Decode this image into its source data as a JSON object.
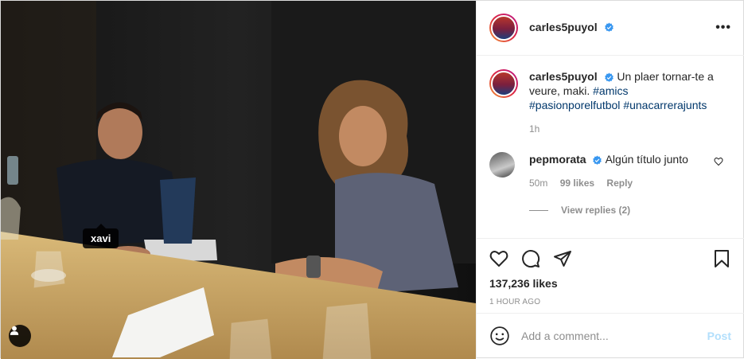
{
  "photo": {
    "tag_label": "xavi",
    "alt": ""
  },
  "header": {
    "username": "carles5puyol",
    "more_label": "•••"
  },
  "caption": {
    "username": "carles5puyol",
    "text": "Un plaer tornar-te a veure, maki.",
    "hashtags": [
      "#amics",
      "#pasionporelfutbol",
      "#unacarrerajunts"
    ],
    "time": "1h"
  },
  "comment": {
    "username": "pepmorata",
    "text": "Algún título junto",
    "time": "50m",
    "likes": "99 likes",
    "reply": "Reply",
    "view_replies": "View replies (2)"
  },
  "actions": {
    "icons": [
      "heart-icon",
      "comment-icon",
      "share-icon",
      "bookmark-icon"
    ],
    "likes": "137,236 likes",
    "ago": "1 HOUR AGO"
  },
  "add_comment": {
    "placeholder": "Add a comment...",
    "post_label": "Post"
  },
  "colors": {
    "link": "#00376b",
    "verified": "#3897f0",
    "post_disabled": "#b2dffc",
    "muted": "#8e8e8e"
  }
}
